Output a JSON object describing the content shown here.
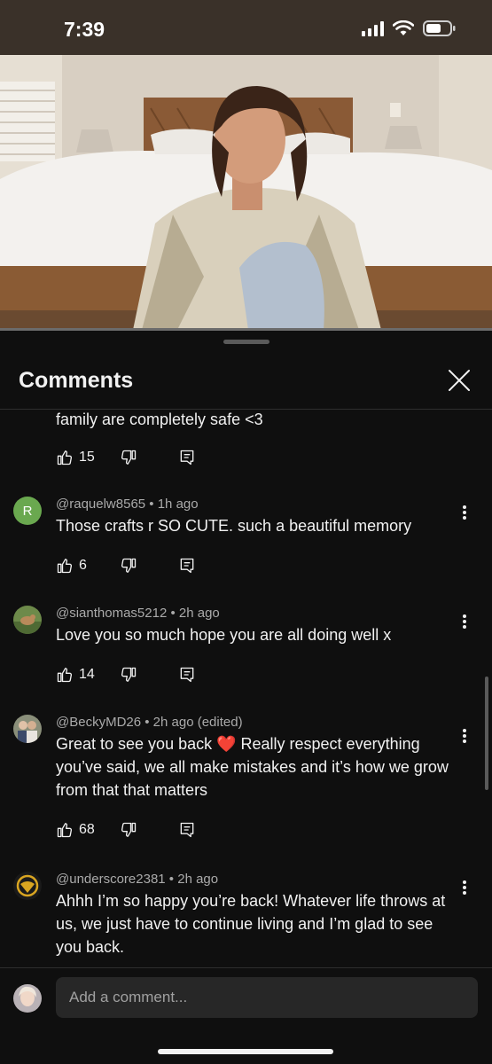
{
  "status_bar": {
    "time": "7:39"
  },
  "sheet": {
    "title": "Comments",
    "close_icon": "close-icon"
  },
  "comments": [
    {
      "partial": true,
      "text": "family are completely safe <3",
      "likes": "15"
    },
    {
      "author": "@raquelw8565",
      "time": "1h ago",
      "meta": "@raquelw8565 • 1h ago",
      "avatar_letter": "R",
      "avatar_color": "#6aa84f",
      "text": "Those crafts r SO CUTE. such a beautiful memory",
      "likes": "6"
    },
    {
      "author": "@sianthomas5212",
      "time": "2h ago",
      "meta": "@sianthomas5212 • 2h ago",
      "text": "Love you so much hope you are all doing well x",
      "likes": "14"
    },
    {
      "author": "@BeckyMD26",
      "time": "2h ago (edited)",
      "meta": "@BeckyMD26 • 2h ago (edited)",
      "text": "Great to see you back ❤️ Really respect everything you’ve said, we all make mistakes and it’s how we grow from that that matters",
      "likes": "68"
    },
    {
      "author": "@underscore2381",
      "time": "2h ago",
      "meta": "@underscore2381 • 2h ago",
      "text": "Ahhh I’m so happy you’re back! Whatever life throws at us, we just have to continue living and I’m glad to see you back."
    }
  ],
  "composer": {
    "placeholder": "Add a comment..."
  },
  "icons": {
    "like": "thumbs-up-icon",
    "dislike": "thumbs-down-icon",
    "reply": "reply-icon",
    "more": "more-vert-icon"
  },
  "colors": {
    "background": "#0f0f0f",
    "input": "#272727",
    "secondary_text": "#aaaaaa",
    "primary_text": "#f1f1f1"
  }
}
